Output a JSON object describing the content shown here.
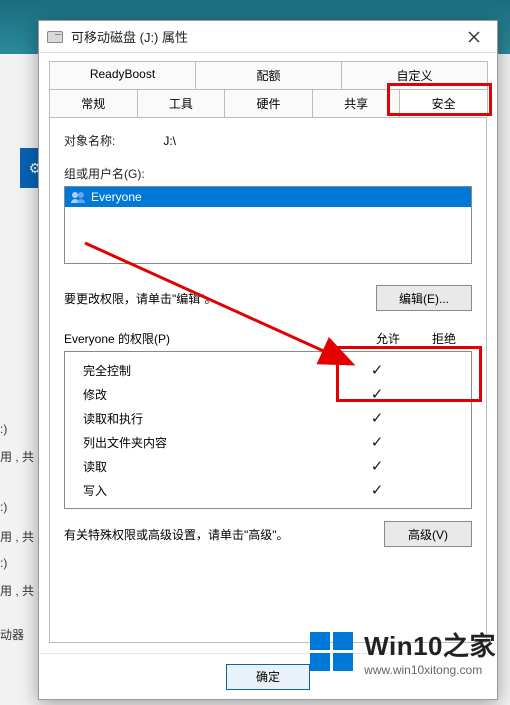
{
  "dialog": {
    "title": "可移动磁盘 (J:) 属性",
    "tabs_row1": [
      "ReadyBoost",
      "配额",
      "自定义"
    ],
    "tabs_row2": [
      "常规",
      "工具",
      "硬件",
      "共享",
      "安全"
    ],
    "object_label": "对象名称:",
    "object_value": "J:\\",
    "groups_label": "组或用户名(G):",
    "user_item": "Everyone",
    "edit_hint": "要更改权限，请单击\"编辑\"。",
    "edit_button": "编辑(E)...",
    "perm_header_label": "Everyone 的权限(P)",
    "perm_allow": "允许",
    "perm_deny": "拒绝",
    "permissions": [
      {
        "name": "完全控制",
        "allow": true,
        "deny": false
      },
      {
        "name": "修改",
        "allow": true,
        "deny": false
      },
      {
        "name": "读取和执行",
        "allow": true,
        "deny": false
      },
      {
        "name": "列出文件夹内容",
        "allow": true,
        "deny": false
      },
      {
        "name": "读取",
        "allow": true,
        "deny": false
      },
      {
        "name": "写入",
        "allow": true,
        "deny": false
      }
    ],
    "advanced_hint": "有关特殊权限或高级设置，请单击\"高级\"。",
    "advanced_button": "高级(V)",
    "ok_button": "确定"
  },
  "background": {
    "frag1": ":)",
    "frag2": "用 , 共",
    "frag3": ":)",
    "frag4": "用 , 共",
    "frag5": ":)",
    "frag6": "用 , 共",
    "frag7": "动器"
  },
  "watermark": {
    "title": "Win10之家",
    "url": "www.win10xitong.com"
  }
}
